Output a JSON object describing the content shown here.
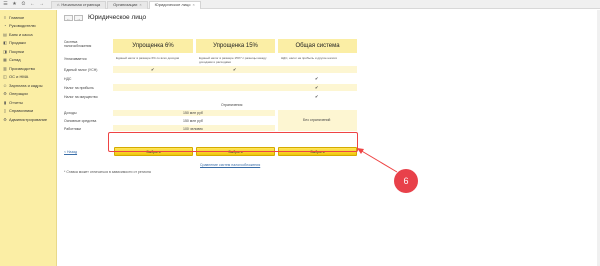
{
  "tabs": [
    {
      "label": "Начальная страница"
    },
    {
      "label": "Организации"
    },
    {
      "label": "Юридическое лицо",
      "active": true
    }
  ],
  "sidebar": {
    "items": [
      {
        "label": "Главное",
        "icon": "hamburger-icon"
      },
      {
        "label": "Руководителю",
        "icon": "chart-icon"
      },
      {
        "label": "Банк и касса",
        "icon": "bank-icon"
      },
      {
        "label": "Продажи",
        "icon": "cart-icon"
      },
      {
        "label": "Покупки",
        "icon": "basket-icon"
      },
      {
        "label": "Склад",
        "icon": "warehouse-icon"
      },
      {
        "label": "Производство",
        "icon": "factory-icon"
      },
      {
        "label": "ОС и НМА",
        "icon": "assets-icon"
      },
      {
        "label": "Зарплата и кадры",
        "icon": "people-icon"
      },
      {
        "label": "Операции",
        "icon": "operations-icon"
      },
      {
        "label": "Отчеты",
        "icon": "reports-icon"
      },
      {
        "label": "Справочники",
        "icon": "book-icon"
      },
      {
        "label": "Администрирование",
        "icon": "gear-icon"
      }
    ]
  },
  "page": {
    "title": "Юридическое лицо"
  },
  "columns": [
    {
      "title": "Упрощенка 6%",
      "description": "Единый налог в размере 6% со всех доходов"
    },
    {
      "title": "Упрощенка 15%",
      "description": "Единый налог в размере 15%* с разницы между доходами и расходами"
    },
    {
      "title": "Общая система",
      "description": "НДС, налог на прибыль и другие налоги"
    }
  ],
  "rows": {
    "system_label": "Система налогообложения",
    "pays_label": "Уплачивается",
    "single_tax": "Единый налог (УСН)",
    "vat": "НДС",
    "profit_tax": "Налог на прибыль",
    "property_tax": "Налог на имущество",
    "limits_label": "Ограничения",
    "income": "Доходы",
    "fixed_assets": "Основные средства",
    "employees": "Работники"
  },
  "limits": {
    "income": "150 млн руб",
    "fixed_assets": "150 млн руб",
    "employees": "100 человек",
    "general": "Без ограничений"
  },
  "checks": {
    "mark": "✔"
  },
  "buttons": {
    "select": "Выбрать"
  },
  "links": {
    "back": "< Назад",
    "compare": "Сравнение систем налогообложения"
  },
  "footnote": "* Ставка может отличаться в зависимости от региона",
  "marker": "6"
}
